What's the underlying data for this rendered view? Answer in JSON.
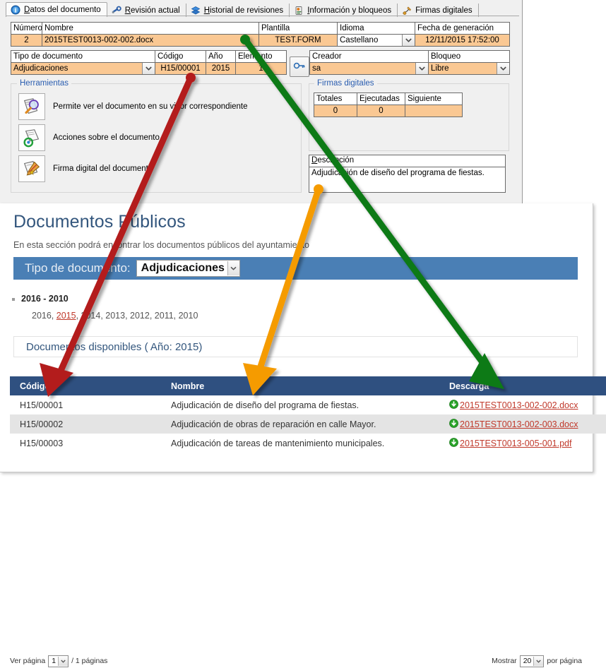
{
  "app": {
    "tabs": [
      {
        "label": "Datos del documento",
        "accel": "D",
        "icon": "info-circle-icon",
        "selected": true
      },
      {
        "label": "Revisión actual",
        "accel": "R",
        "icon": "wrench-icon",
        "selected": false
      },
      {
        "label": "Historial de revisiones",
        "accel": "H",
        "icon": "layers-icon",
        "selected": false
      },
      {
        "label": "Información y bloqueos",
        "accel": "I",
        "icon": "lock-info-icon",
        "selected": false
      },
      {
        "label": "Firmas digitales",
        "accel": "",
        "icon": "signature-icon",
        "selected": false
      }
    ],
    "row1": {
      "headers": [
        "Número",
        "Nombre",
        "Plantilla",
        "Idioma",
        "Fecha de generación"
      ],
      "values": {
        "numero": "2",
        "nombre": "2015TEST0013-002-002.docx",
        "plantilla": "TEST.FORM",
        "idioma": "Castellano",
        "fecha": "12/11/2015 17:52:00"
      }
    },
    "row2": {
      "headers": [
        "Tipo de documento",
        "Código",
        "Año",
        "Elemento",
        "Creador",
        "Bloqueo"
      ],
      "values": {
        "tipo": "Adjudicaciones",
        "codigo": "H15/00001",
        "anio": "2015",
        "elemento": "1",
        "creador": "sa",
        "bloqueo": "Libre"
      },
      "key_button_icon": "key-icon"
    },
    "herramientas": {
      "title": "Herramientas",
      "items": [
        {
          "icon": "magnifier-document-icon",
          "label": "Permite ver el documento en su visor correspondiente"
        },
        {
          "icon": "document-actions-icon",
          "label": "Acciones sobre el documento"
        },
        {
          "icon": "digital-signature-icon",
          "label": "Firma digital del documento"
        }
      ]
    },
    "firmas": {
      "title": "Firmas digitales",
      "headers": [
        "Totales",
        "Ejecutadas",
        "Siguiente"
      ],
      "values": [
        "0",
        "0",
        ""
      ]
    },
    "descripcion": {
      "label": "Descripción",
      "accel": "e",
      "text": "Adjudicación de diseño del programa de fiestas."
    }
  },
  "web": {
    "title": "Documentos Públicos",
    "subtitle": "En esta sección podrá encontrar los documentos públicos del ayuntamiento",
    "filter": {
      "label": "Tipo de documento:",
      "selected": "Adjudicaciones"
    },
    "years": {
      "group_label": "2016 - 2010",
      "list_prefix": "2016, ",
      "active": "2015",
      "list_suffix": ", 2014, 2013, 2012, 2011, 2010"
    },
    "available_label": "Documentos disponibles ( Año: 2015)",
    "table": {
      "headers": [
        "Código",
        "Nombre",
        "Descarga"
      ],
      "rows": [
        {
          "codigo": "H15/00001",
          "nombre": "Adjudicación de diseño del programa de fiestas.",
          "descarga": "2015TEST0013-002-002.docx",
          "icon": "download-green-icon"
        },
        {
          "codigo": "H15/00002",
          "nombre": "Adjudicación de obras de reparación en calle Mayor.",
          "descarga": "2015TEST0013-002-003.docx",
          "icon": "download-green-icon"
        },
        {
          "codigo": "H15/00003",
          "nombre": "Adjudicación de tareas de mantenimiento municipales.",
          "descarga": "2015TEST0013-005-001.pdf",
          "icon": "download-green-icon"
        }
      ]
    },
    "pager": {
      "ver_pagina": "Ver página",
      "current_page": "1",
      "total_pages": "/ 1 páginas",
      "mostrar": "Mostrar",
      "per_page": "20",
      "por_pagina": "por página"
    }
  },
  "annotations": {
    "arrows": [
      {
        "name": "codigo-mapping-arrow",
        "color": "#b31b1b",
        "from": "app.row2.codigo",
        "to": "web.table.header.codigo"
      },
      {
        "name": "nombre-mapping-arrow",
        "color": "#f59b00",
        "from": "app.descripcion",
        "to": "web.table.header.nombre"
      },
      {
        "name": "descarga-mapping-arrow",
        "color": "#0c7a18",
        "from": "app.row1.nombre",
        "to": "web.table.header.descarga"
      }
    ]
  },
  "colors": {
    "field_value_bg": "#fac893",
    "web_bar_blue": "#4a7fb5",
    "table_header_navy": "#2f5080",
    "link_red": "#c0392b",
    "download_green": "#29a329",
    "heading_blue": "#33567d"
  }
}
